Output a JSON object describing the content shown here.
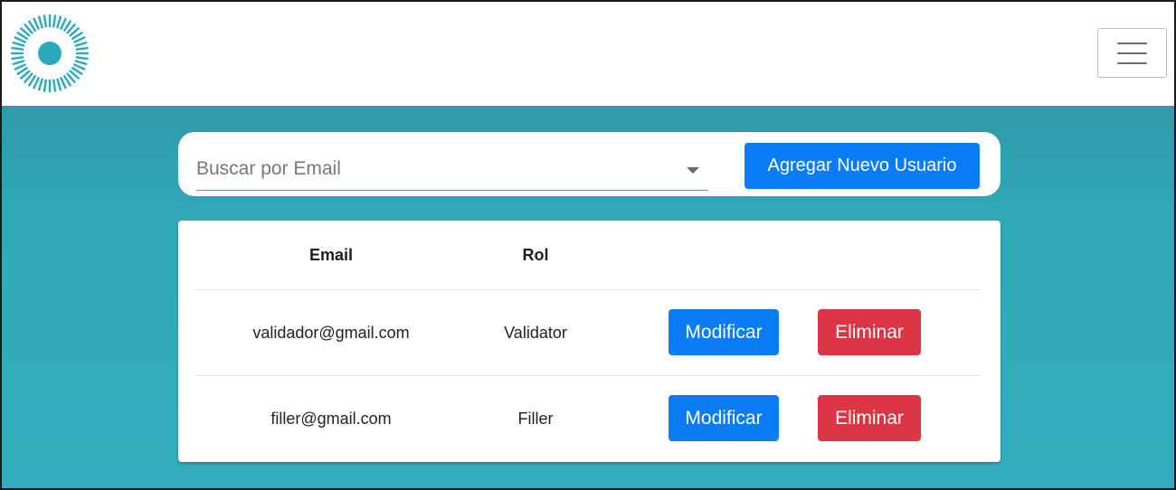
{
  "header": {
    "logo_icon": "sunburst-logo-icon",
    "menu_icon": "hamburger-menu-icon",
    "brand_color": "#2aa9bb"
  },
  "search": {
    "placeholder": "Buscar por Email",
    "value": "",
    "dropdown_icon": "caret-down-icon",
    "add_button_label": "Agregar Nuevo Usuario"
  },
  "table": {
    "columns": [
      "Email",
      "Rol"
    ],
    "rows": [
      {
        "email": "validador@gmail.com",
        "role": "Validator",
        "modify_label": "Modificar",
        "delete_label": "Eliminar"
      },
      {
        "email": "filler@gmail.com",
        "role": "Filler",
        "modify_label": "Modificar",
        "delete_label": "Eliminar"
      }
    ]
  },
  "colors": {
    "primary": "#0a7cf6",
    "danger": "#dc3545",
    "background": "#33adbd"
  }
}
